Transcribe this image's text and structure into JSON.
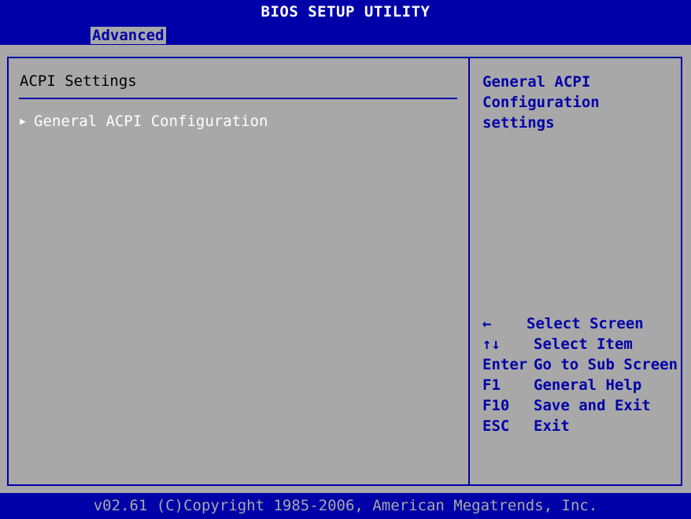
{
  "app_title": "BIOS SETUP UTILITY",
  "menu": {
    "active_tab": "Advanced"
  },
  "main": {
    "section_title": "ACPI Settings",
    "items": [
      {
        "label": "General ACPI Configuration"
      }
    ]
  },
  "help": {
    "text": "General ACPI\nConfiguration settings",
    "keys": [
      {
        "key": "←",
        "action": "Select Screen"
      },
      {
        "key": "↑↓",
        "action": "Select Item"
      },
      {
        "key": "Enter",
        "action": "Go to Sub Screen"
      },
      {
        "key": "F1",
        "action": "General Help"
      },
      {
        "key": "F10",
        "action": "Save and Exit"
      },
      {
        "key": "ESC",
        "action": "Exit"
      }
    ]
  },
  "footer": "v02.61 (C)Copyright 1985-2006, American Megatrends, Inc.",
  "colors": {
    "background_blue": "#0000a8",
    "panel_gray": "#a8a8a8",
    "highlight_white": "#ffffff"
  }
}
